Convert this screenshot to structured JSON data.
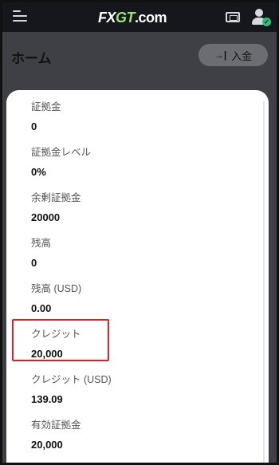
{
  "topbar": {
    "menu_icon": "hamburger-menu-icon",
    "logo_text_a": "FX",
    "logo_text_b": "GT",
    "logo_text_c": ".com",
    "ticket_icon": "ticket-icon",
    "account_icon": "user-verified-icon"
  },
  "header": {
    "title": "ホーム",
    "deposit_label": "入金",
    "deposit_icon": "→|"
  },
  "account_details": [
    {
      "label": "証拠金",
      "value": "0"
    },
    {
      "label": "証拠金レベル",
      "value": "0%"
    },
    {
      "label": "余剰証拠金",
      "value": "20000"
    },
    {
      "label": "残高",
      "value": "0"
    },
    {
      "label": "残高 (USD)",
      "value": "0.00"
    },
    {
      "label": "クレジット",
      "value": "20,000"
    },
    {
      "label": "クレジット (USD)",
      "value": "139.09"
    },
    {
      "label": "有効証拠金",
      "value": "20,000"
    }
  ],
  "colors": {
    "highlight_box": "#e02020",
    "logo_accent": "#9be27a",
    "verified_badge": "#31c07a"
  }
}
